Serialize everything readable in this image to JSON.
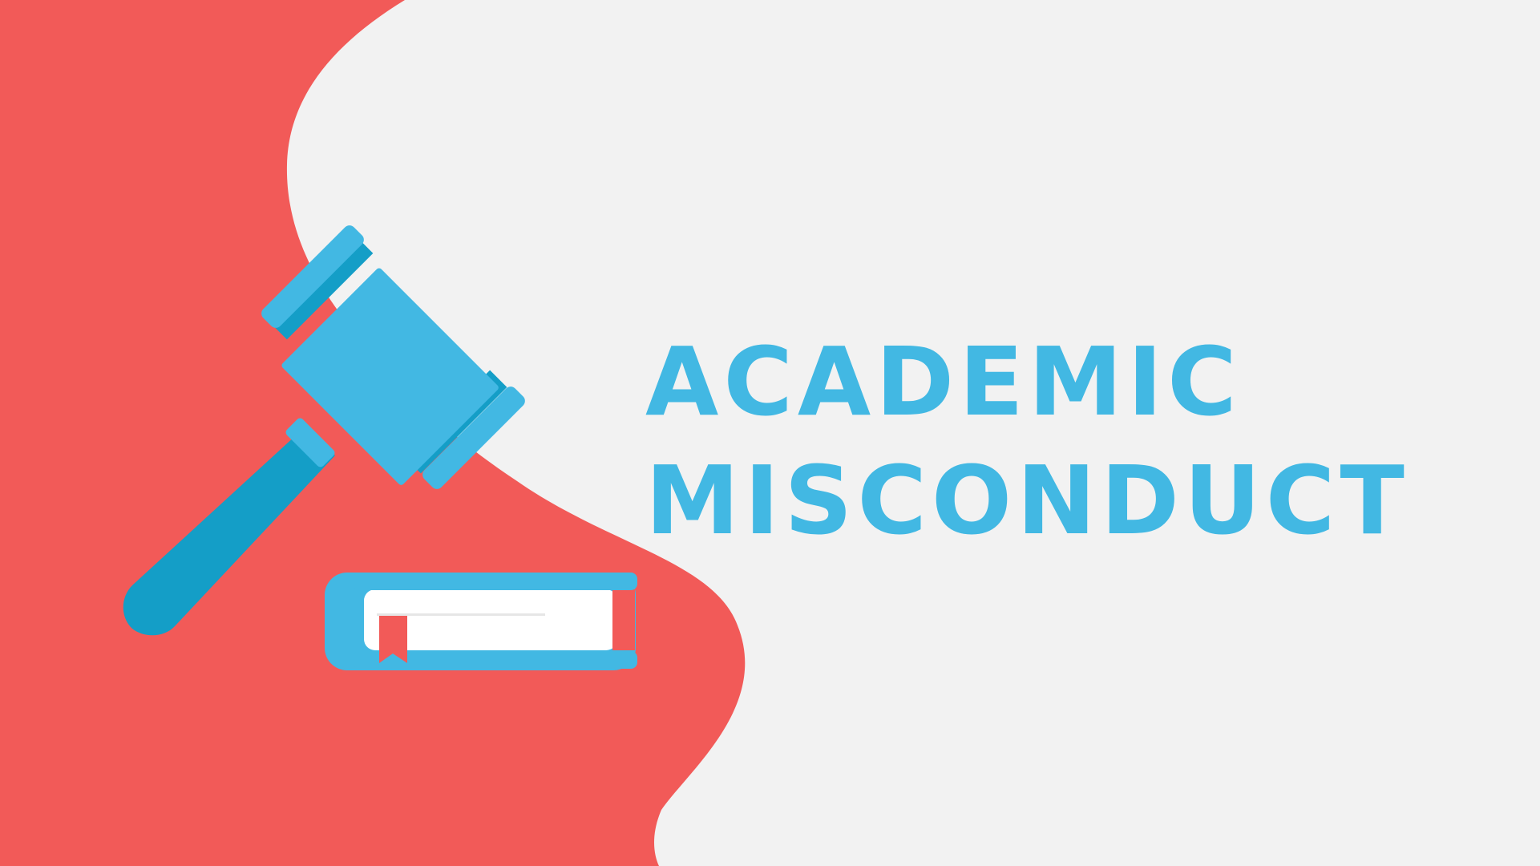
{
  "title": {
    "line1": "ACADEMIC",
    "line2": "MISCONDUCT"
  },
  "colors": {
    "background": "#f2f2f2",
    "blob": "#f25a58",
    "accent_blue": "#42b8e3",
    "dark_blue": "#149ec7",
    "book_pages": "#ffffff",
    "bookmark": "#f25a58"
  },
  "icons": {
    "gavel": "gavel-icon",
    "book": "book-icon",
    "bookmark": "bookmark-icon"
  }
}
